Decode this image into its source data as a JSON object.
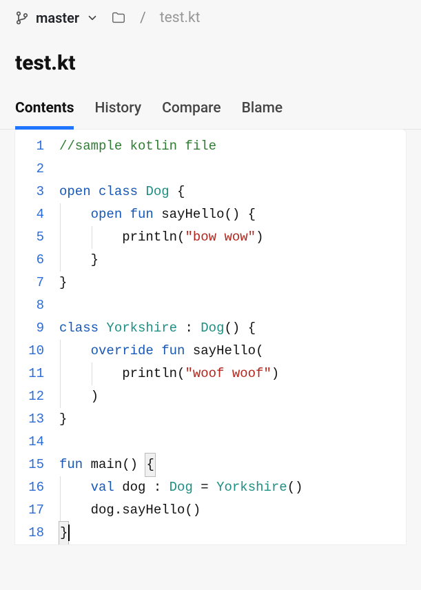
{
  "topbar": {
    "branch": "master",
    "filename": "test.kt",
    "separator": "/"
  },
  "title": "test.kt",
  "tabs": [
    {
      "label": "Contents",
      "active": true
    },
    {
      "label": "History",
      "active": false
    },
    {
      "label": "Compare",
      "active": false
    },
    {
      "label": "Blame",
      "active": false
    }
  ],
  "code": {
    "lines": [
      {
        "n": 1,
        "tokens": [
          {
            "t": "comment",
            "v": "//sample kotlin file"
          }
        ]
      },
      {
        "n": 2,
        "tokens": []
      },
      {
        "n": 3,
        "tokens": [
          {
            "t": "keyword",
            "v": "open"
          },
          {
            "t": "plain",
            "v": " "
          },
          {
            "t": "keyword",
            "v": "class"
          },
          {
            "t": "plain",
            "v": " "
          },
          {
            "t": "type",
            "v": "Dog"
          },
          {
            "t": "plain",
            "v": " {"
          }
        ]
      },
      {
        "n": 4,
        "indent": 1,
        "tokens": [
          {
            "t": "plain",
            "v": "    "
          },
          {
            "t": "keyword",
            "v": "open"
          },
          {
            "t": "plain",
            "v": " "
          },
          {
            "t": "keyword",
            "v": "fun"
          },
          {
            "t": "plain",
            "v": " "
          },
          {
            "t": "fn",
            "v": "sayHello"
          },
          {
            "t": "plain",
            "v": "() {"
          }
        ]
      },
      {
        "n": 5,
        "indent": 2,
        "tokens": [
          {
            "t": "plain",
            "v": "        println("
          },
          {
            "t": "string",
            "v": "\"bow wow\""
          },
          {
            "t": "plain",
            "v": ")"
          }
        ]
      },
      {
        "n": 6,
        "indent": 1,
        "tokens": [
          {
            "t": "plain",
            "v": "    }"
          }
        ]
      },
      {
        "n": 7,
        "tokens": [
          {
            "t": "plain",
            "v": "}"
          }
        ]
      },
      {
        "n": 8,
        "tokens": []
      },
      {
        "n": 9,
        "tokens": [
          {
            "t": "keyword",
            "v": "class"
          },
          {
            "t": "plain",
            "v": " "
          },
          {
            "t": "type",
            "v": "Yorkshire"
          },
          {
            "t": "plain",
            "v": " : "
          },
          {
            "t": "type",
            "v": "Dog"
          },
          {
            "t": "plain",
            "v": "() {"
          }
        ]
      },
      {
        "n": 10,
        "indent": 1,
        "tokens": [
          {
            "t": "plain",
            "v": "    "
          },
          {
            "t": "keyword",
            "v": "override"
          },
          {
            "t": "plain",
            "v": " "
          },
          {
            "t": "keyword",
            "v": "fun"
          },
          {
            "t": "plain",
            "v": " "
          },
          {
            "t": "fn",
            "v": "sayHello"
          },
          {
            "t": "plain",
            "v": "("
          }
        ]
      },
      {
        "n": 11,
        "indent": 2,
        "tokens": [
          {
            "t": "plain",
            "v": "        println("
          },
          {
            "t": "string",
            "v": "\"woof woof\""
          },
          {
            "t": "plain",
            "v": ")"
          }
        ]
      },
      {
        "n": 12,
        "indent": 1,
        "tokens": [
          {
            "t": "plain",
            "v": "    )"
          }
        ]
      },
      {
        "n": 13,
        "tokens": [
          {
            "t": "plain",
            "v": "}"
          }
        ]
      },
      {
        "n": 14,
        "tokens": []
      },
      {
        "n": 15,
        "tokens": [
          {
            "t": "keyword",
            "v": "fun"
          },
          {
            "t": "plain",
            "v": " "
          },
          {
            "t": "fn",
            "v": "main"
          },
          {
            "t": "plain",
            "v": "() "
          },
          {
            "t": "boxed",
            "v": "{"
          }
        ]
      },
      {
        "n": 16,
        "indent": 1,
        "tokens": [
          {
            "t": "plain",
            "v": "    "
          },
          {
            "t": "keyword",
            "v": "val"
          },
          {
            "t": "plain",
            "v": " dog : "
          },
          {
            "t": "type",
            "v": "Dog"
          },
          {
            "t": "plain",
            "v": " = "
          },
          {
            "t": "type",
            "v": "Yorkshire"
          },
          {
            "t": "plain",
            "v": "()"
          }
        ]
      },
      {
        "n": 17,
        "indent": 1,
        "tokens": [
          {
            "t": "plain",
            "v": "    dog.sayHello()"
          }
        ]
      },
      {
        "n": 18,
        "tokens": [
          {
            "t": "boxed",
            "v": "}"
          },
          {
            "t": "cursor",
            "v": ""
          }
        ]
      }
    ]
  }
}
